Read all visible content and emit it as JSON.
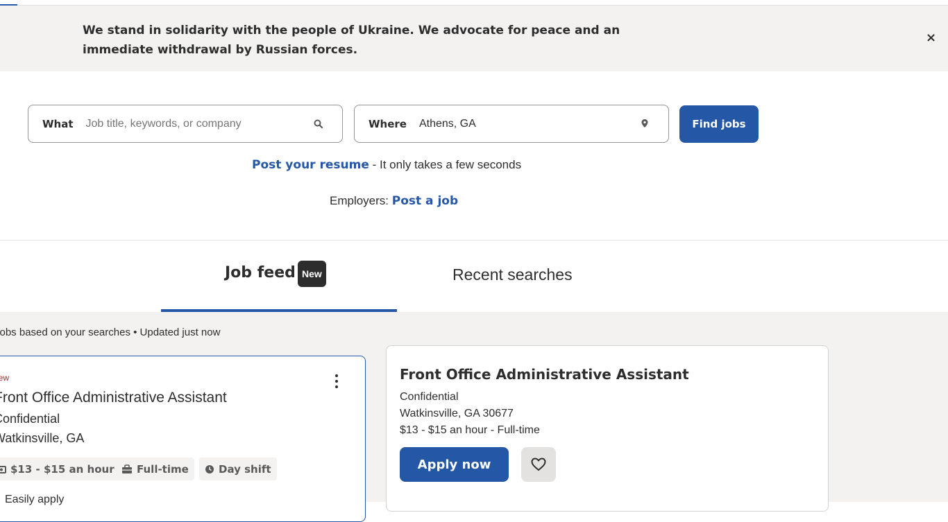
{
  "banner": {
    "message": "We stand in solidarity with the people of Ukraine. We advocate for peace and an immediate withdrawal by Russian forces.",
    "close_icon": "×"
  },
  "search": {
    "what_label": "What",
    "what_placeholder": "Job title, keywords, or company",
    "what_value": "",
    "where_label": "Where",
    "where_value": "Athens, GA",
    "find_button": "Find jobs"
  },
  "resume": {
    "link": "Post your resume",
    "suffix": " - It only takes a few seconds"
  },
  "employers": {
    "prefix": "Employers: ",
    "link": "Post a job"
  },
  "tabs": {
    "feed_label": "Job feed",
    "feed_badge": "New",
    "recent_label": "Recent searches"
  },
  "feed": {
    "meta": "Jobs based on your searches • Updated just now"
  },
  "job_card": {
    "new_label": "new",
    "title": "Front Office Administrative Assistant",
    "company": "Confidential",
    "location": "Watkinsville, GA",
    "salary": "$13 - $15 an hour",
    "job_type": "Full-time",
    "shift": "Day shift",
    "easy_apply": "Easily apply"
  },
  "detail": {
    "title": "Front Office Administrative Assistant",
    "company": "Confidential",
    "location": "Watkinsville, GA 30677",
    "pay": "$13 - $15 an hour  - Full-time",
    "apply_button": "Apply now"
  },
  "colors": {
    "brand_blue": "#2557a7",
    "new_red": "#a9252b",
    "banner_bg": "#f3f2f1"
  }
}
